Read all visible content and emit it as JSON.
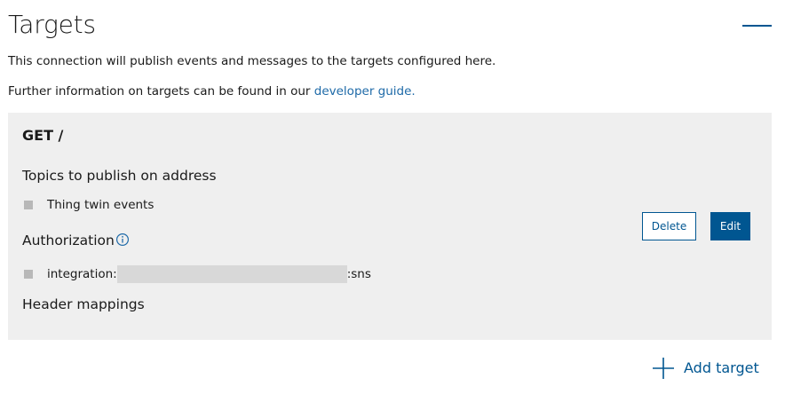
{
  "header": {
    "title": "Targets",
    "collapse_icon": "minus-icon"
  },
  "description": {
    "line1": "This connection will publish events and messages to the targets configured here.",
    "line2_prefix": "Further information on targets can be found in our ",
    "line2_link": "developer guide."
  },
  "target": {
    "title": "GET /",
    "topics_label": "Topics to publish on address",
    "topics": [
      {
        "label": "Thing twin events"
      }
    ],
    "authorization_label": "Authorization",
    "authorization_icon": "info-icon",
    "authorization_items": [
      {
        "prefix": "integration:",
        "suffix": ":sns"
      }
    ],
    "header_mappings_label": "Header mappings",
    "delete_label": "Delete",
    "edit_label": "Edit"
  },
  "actions": {
    "add_target_label": "Add target",
    "add_target_icon": "plus-icon"
  },
  "colors": {
    "accent": "#005691",
    "link": "#1e6aa8",
    "card_bg": "#efefef",
    "bullet": "#b8b8b8",
    "redacted": "#d8d8d8"
  }
}
